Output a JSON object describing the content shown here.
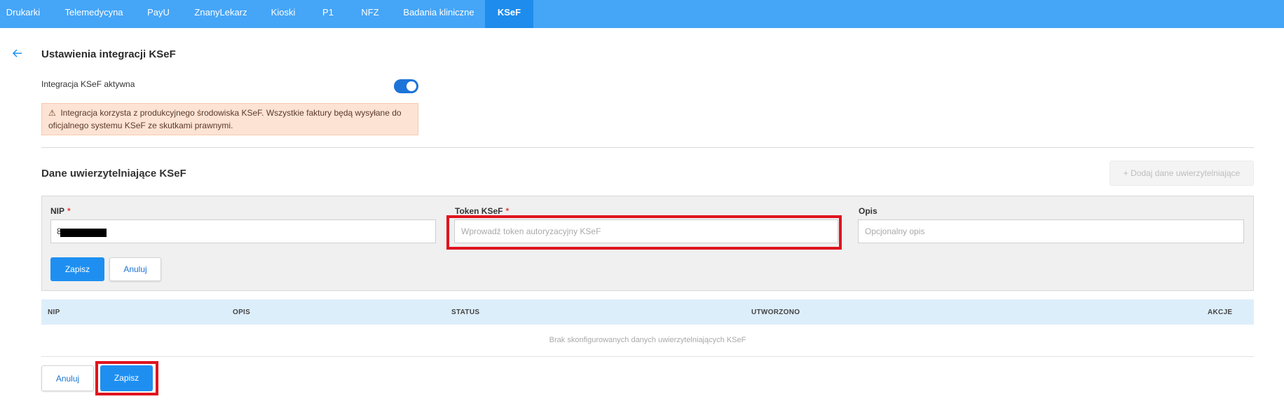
{
  "nav": {
    "tabs": [
      {
        "label": "Drukarki"
      },
      {
        "label": "Telemedycyna"
      },
      {
        "label": "PayU"
      },
      {
        "label": "ZnanyLekarz"
      },
      {
        "label": "Kioski"
      },
      {
        "label": "P1"
      },
      {
        "label": "NFZ"
      },
      {
        "label": "Badania kliniczne"
      },
      {
        "label": "KSeF"
      }
    ],
    "active": "KSeF"
  },
  "page": {
    "title": "Ustawienia integracji KSeF",
    "back_icon": "arrow-left-icon"
  },
  "integration": {
    "toggle_label": "Integracja KSeF aktywna",
    "enabled": true,
    "warning_icon": "warning-icon",
    "warning_text": "Integracja korzysta z produkcyjnego środowiska KSeF. Wszystkie faktury będą wysyłane do oficjalnego systemu KSeF ze skutkami prawnymi."
  },
  "credentials": {
    "section_title": "Dane uwierzytelniające KSeF",
    "add_button_label": "+ Dodaj dane uwierzytelniające",
    "form": {
      "nip_label": "NIP",
      "nip_value_visible": "8",
      "required_mark": "*",
      "token_label": "Token KSeF",
      "token_placeholder": "Wprowadź token autoryzacyjny KSeF",
      "desc_label": "Opis",
      "desc_placeholder": "Opcjonalny opis",
      "save_label": "Zapisz",
      "cancel_label": "Anuluj"
    },
    "table": {
      "columns": [
        "NIP",
        "OPIS",
        "STATUS",
        "UTWORZONO",
        "AKCJE"
      ],
      "empty_text": "Brak skonfigurowanych danych uwierzytelniających KSeF"
    }
  },
  "footer": {
    "cancel_label": "Anuluj",
    "save_label": "Zapisz"
  },
  "colors": {
    "nav_bg": "#45a5f7",
    "nav_active": "#1d8cec",
    "primary": "#1e8ff1",
    "highlight": "#e0141e",
    "warning_bg": "#fde3d4"
  }
}
